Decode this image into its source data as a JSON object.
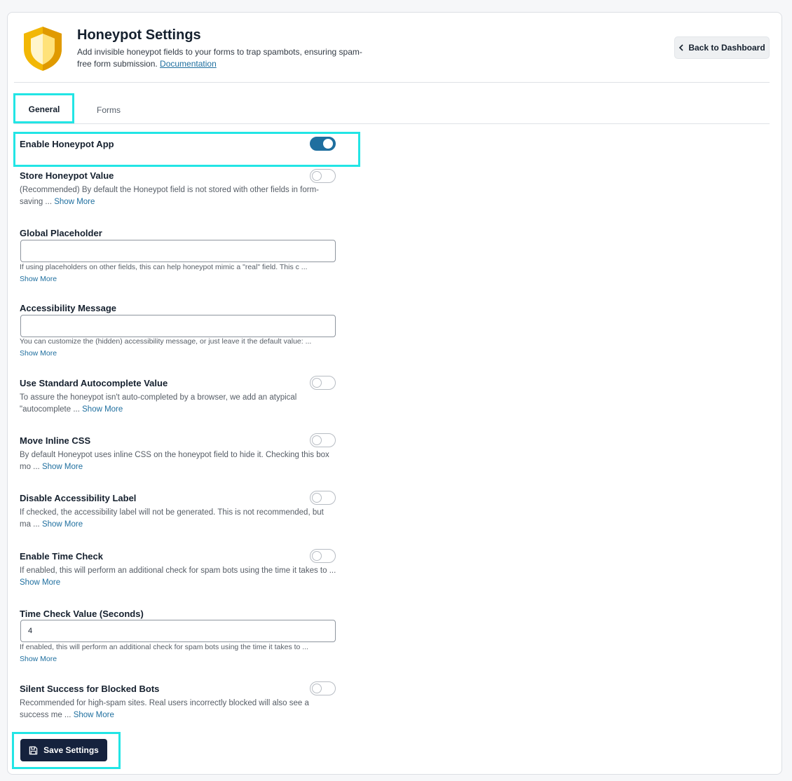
{
  "header": {
    "title": "Honeypot Settings",
    "description": "Add invisible honeypot fields to your forms to trap spambots, ensuring spam-free form submission.",
    "doc_link": "Documentation",
    "back_label": "Back to Dashboard",
    "logo_icon": "shield-icon",
    "brand_color": "#f2b705"
  },
  "tabs": [
    {
      "label": "General",
      "active": true
    },
    {
      "label": "Forms",
      "active": false
    }
  ],
  "settings": {
    "enable_app": {
      "label": "Enable Honeypot App",
      "enabled": true
    },
    "store_value": {
      "label": "Store Honeypot Value",
      "enabled": false,
      "desc": "(Recommended) By default the Honeypot field is not stored with other fields in form-saving ...",
      "more": "Show More"
    },
    "global_placeholder": {
      "label": "Global Placeholder",
      "value": "",
      "desc": "If using placeholders on other fields, this can help honeypot mimic a \"real\" field. This c ...",
      "more": "Show More"
    },
    "accessibility_message": {
      "label": "Accessibility Message",
      "value": "",
      "desc": "You can customize the (hidden) accessibility message, or just leave it the default value: ...",
      "more": "Show More"
    },
    "autocomplete": {
      "label": "Use Standard Autocomplete Value",
      "enabled": false,
      "desc": "To assure the honeypot isn't auto-completed by a browser, we add an atypical \"autocomplete ...",
      "more": "Show More"
    },
    "inline_css": {
      "label": "Move Inline CSS",
      "enabled": false,
      "desc": "By default Honeypot uses inline CSS on the honeypot field to hide it. Checking this box mo ...",
      "more": "Show More"
    },
    "disable_label": {
      "label": "Disable Accessibility Label",
      "enabled": false,
      "desc": "If checked, the accessibility label will not be generated. This is not recommended, but ma ...",
      "more": "Show More"
    },
    "time_check": {
      "label": "Enable Time Check",
      "enabled": false,
      "desc": "If enabled, this will perform an additional check for spam bots using the time it takes to ...",
      "more": "Show More"
    },
    "time_check_value": {
      "label": "Time Check Value (Seconds)",
      "value": "4",
      "desc": "If enabled, this will perform an additional check for spam bots using the time it takes to ...",
      "more": "Show More"
    },
    "silent_success": {
      "label": "Silent Success for Blocked Bots",
      "enabled": false,
      "desc": "Recommended for high-spam sites. Real users incorrectly blocked will also see a success me ...",
      "more": "Show More"
    }
  },
  "save_label": "Save Settings",
  "colors": {
    "accent": "#1f6f9f",
    "save_bg": "#15223d",
    "highlight": "#22e5e5"
  }
}
